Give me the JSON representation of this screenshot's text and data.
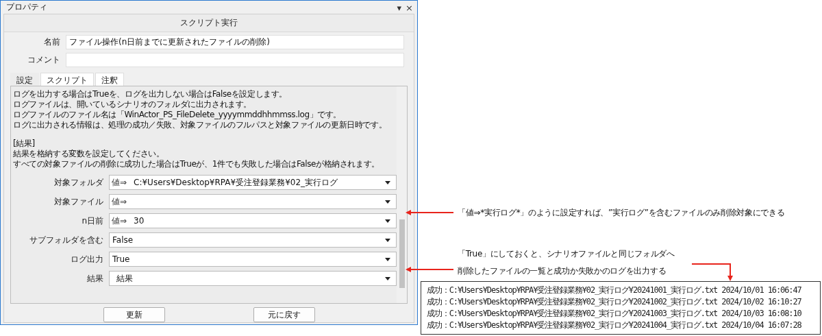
{
  "window": {
    "title": "プロパティ",
    "menu_glyph": "▾",
    "close_glyph": "×"
  },
  "header": "スクリプト実行",
  "name_field": {
    "label": "名前",
    "value": "ファイル操作(n日前までに更新されたファイルの削除)"
  },
  "comment_field": {
    "label": "コメント"
  },
  "tabs": [
    {
      "label": "設定",
      "selected": true
    },
    {
      "label": "スクリプト",
      "selected": false
    },
    {
      "label": "注釈",
      "selected": false
    }
  ],
  "description": [
    [
      "ログを出力する場合はTrueを、ログを出力しない場合はFalseを設定します。",
      "ログファイルは、開いているシナリオのフォルダに出力されます。",
      "ログファイルのファイル名は「WinActor_PS_FileDelete_yyyymmddhhmmss.log」です。",
      "ログに出力される情報は、処理の成功／失敗、対象ファイルのフルパスと対象ファイルの更新日時です。"
    ],
    [
      "[結果]",
      "結果を格納する変数を設定してください。",
      "すべての対象ファイルの削除に成功した場合はTrueが、1件でも失敗した場合はFalseが格納されます。"
    ]
  ],
  "parameters": [
    {
      "label": "対象フォルダ",
      "prefix": "値⇒",
      "value": "C:¥Users¥Desktop¥RPA¥受注登録業務¥02_実行ログ"
    },
    {
      "label": "対象ファイル",
      "prefix": "値⇒"
    },
    {
      "label": "n日前",
      "prefix": "値⇒",
      "value": "30"
    },
    {
      "label": "サブフォルダを含む",
      "value": "False"
    },
    {
      "label": "ログ出力",
      "value": "True"
    },
    {
      "label": "結果",
      "value": "結果",
      "indent": true
    }
  ],
  "buttons": [
    "更新",
    "元に戻す"
  ],
  "annotations": [
    {
      "lines": [
        "「値⇒*実行ログ*」のように設定すれば、”実行ログ”を含むファイルのみ削除対象にできる"
      ]
    },
    {
      "lines": [
        "「True」にしておくと、シナリオファイルと同じフォルダへ",
        "削除したファイルの一覧と成功か失敗かのログを出力する"
      ]
    }
  ],
  "log_lines": [
    "成功：C:¥Users¥Desktop¥RPA¥受注登録業務¥02_実行ログ¥20241001_実行ログ.txt 2024/10/01 16:06:47",
    "成功：C:¥Users¥Desktop¥RPA¥受注登録業務¥02_実行ログ¥20241002_実行ログ.txt 2024/10/02 16:10:27",
    "成功：C:¥Users¥Desktop¥RPA¥受注登録業務¥02_実行ログ¥20241003_実行ログ.txt 2024/10/03 16:08:10",
    "成功：C:¥Users¥Desktop¥RPA¥受注登録業務¥02_実行ログ¥20241004_実行ログ.txt 2024/10/04 16:07:28"
  ]
}
